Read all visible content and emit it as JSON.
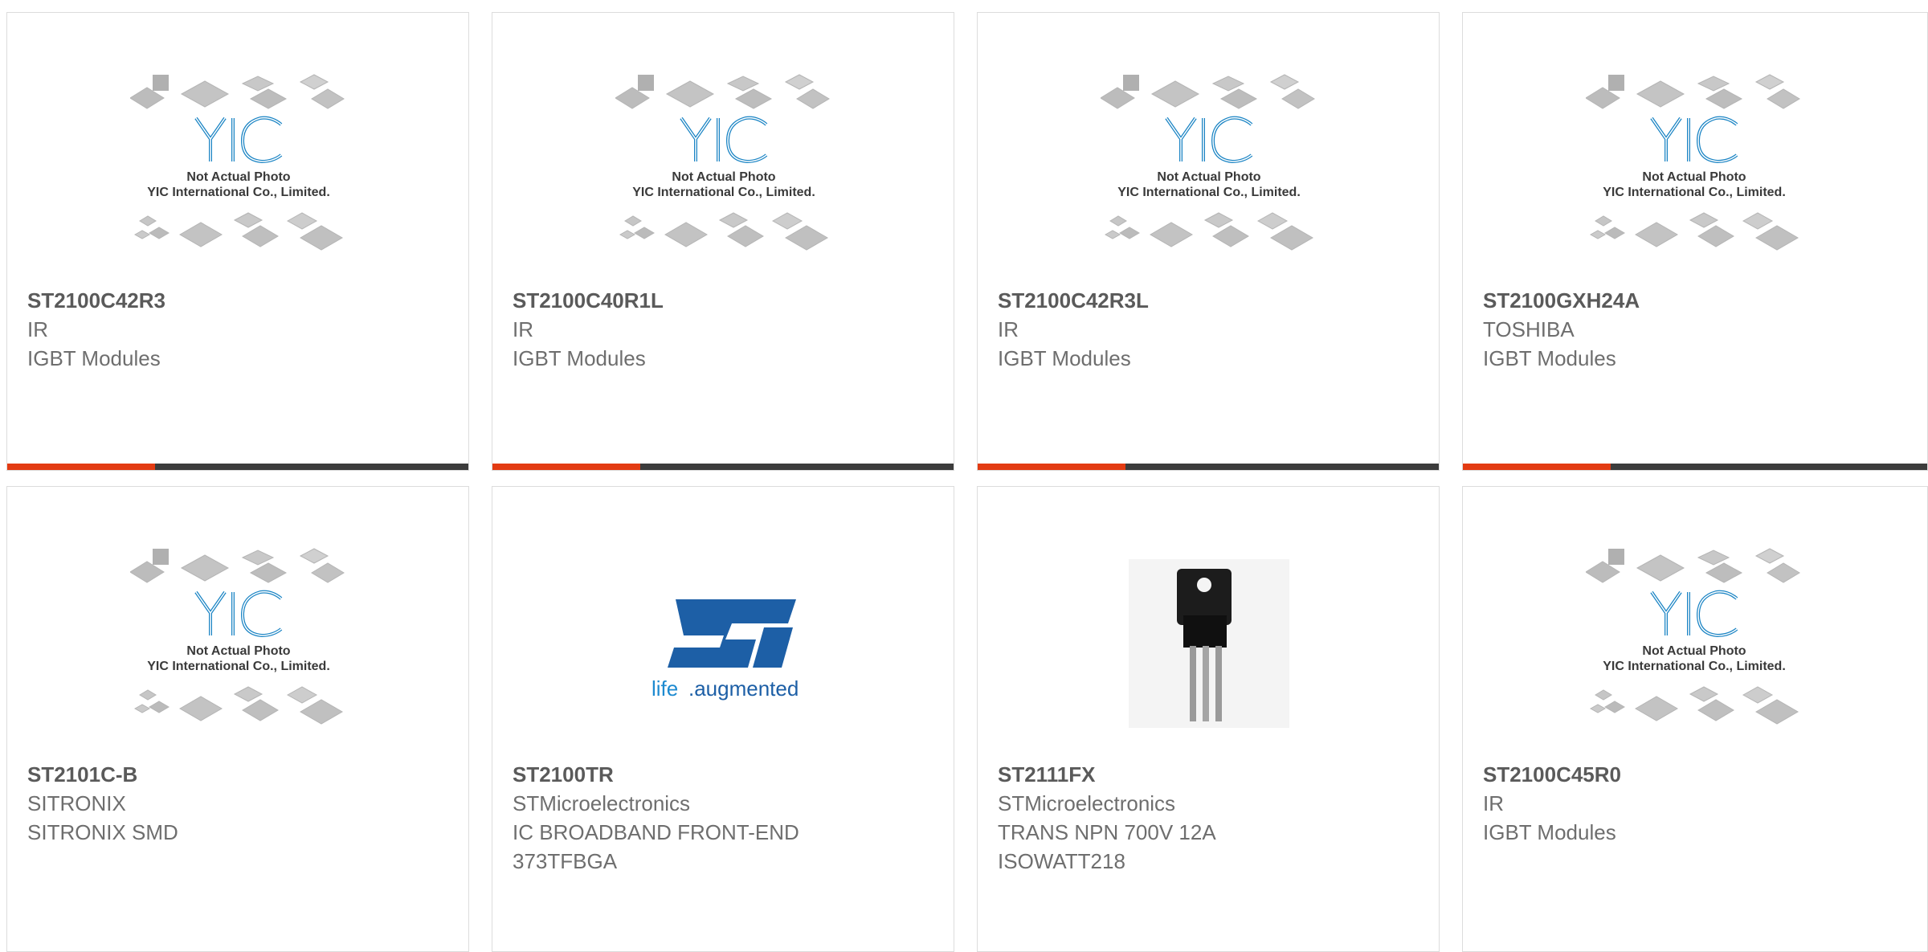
{
  "colors": {
    "accent": "#e33b12",
    "bar_dark": "#3c3c3c",
    "yic_blue": "#1a84c4",
    "st_blue": "#1d5fa6",
    "text_gray": "#6e6e6e"
  },
  "placeholder": {
    "line1": "Not Actual Photo",
    "line2": "YIC International Co., Limited.",
    "logo_text": "YIC"
  },
  "st_logo": {
    "text_life": "life",
    "text_augmented": ".augmented"
  },
  "products": [
    {
      "part": "ST2100C42R3",
      "brand": "IR",
      "desc_line1": "IGBT Modules",
      "desc_line2": "",
      "image": "yic-placeholder"
    },
    {
      "part": "ST2100C40R1L",
      "brand": "IR",
      "desc_line1": "IGBT Modules",
      "desc_line2": "",
      "image": "yic-placeholder"
    },
    {
      "part": "ST2100C42R3L",
      "brand": "IR",
      "desc_line1": "IGBT Modules",
      "desc_line2": "",
      "image": "yic-placeholder"
    },
    {
      "part": "ST2100GXH24A",
      "brand": "TOSHIBA",
      "desc_line1": "IGBT Modules",
      "desc_line2": "",
      "image": "yic-placeholder"
    },
    {
      "part": "ST2101C-B",
      "brand": "SITRONIX",
      "desc_line1": "SITRONIX SMD",
      "desc_line2": "",
      "image": "yic-placeholder"
    },
    {
      "part": "ST2100TR",
      "brand": "STMicroelectronics",
      "desc_line1": "IC BROADBAND FRONT-END",
      "desc_line2": "373TFBGA",
      "image": "st-logo"
    },
    {
      "part": "ST2111FX",
      "brand": "STMicroelectronics",
      "desc_line1": "TRANS NPN 700V 12A",
      "desc_line2": "ISOWATT218",
      "image": "transistor-photo"
    },
    {
      "part": "ST2100C45R0",
      "brand": "IR",
      "desc_line1": "IGBT Modules",
      "desc_line2": "",
      "image": "yic-placeholder"
    }
  ]
}
